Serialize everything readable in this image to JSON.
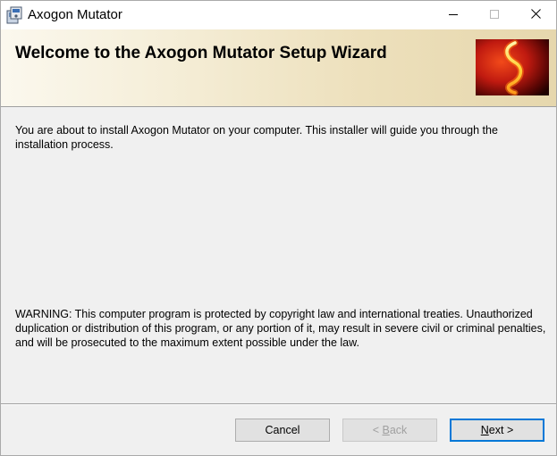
{
  "window": {
    "title": "Axogon Mutator",
    "app_icon": "installer-icon"
  },
  "caption_buttons": {
    "minimize": "minimize-icon",
    "maximize": "maximize-icon",
    "close": "close-icon"
  },
  "banner": {
    "title": "Welcome to the Axogon Mutator Setup Wizard",
    "logo": "swirl-logo-icon"
  },
  "content": {
    "intro": "You are about to install Axogon Mutator on your computer. This installer will guide you through the installation process.",
    "warning": "WARNING: This computer program is protected by copyright law and international treaties. Unauthorized duplication or distribution of this program, or any portion of it, may result in severe civil or criminal penalties, and will be prosecuted to the maximum extent possible under the law."
  },
  "buttons": {
    "cancel": "Cancel",
    "back_arrow": "<",
    "back_mnemonic": "B",
    "back_rest": "ack",
    "next_mnemonic": "N",
    "next_rest": "ext",
    "next_arrow": ">"
  },
  "colors": {
    "accent": "#0078d7",
    "disabled_text": "#a0a0a0",
    "banner_gradient_start": "#fbf8ee",
    "banner_gradient_end": "#e6d7ad"
  }
}
